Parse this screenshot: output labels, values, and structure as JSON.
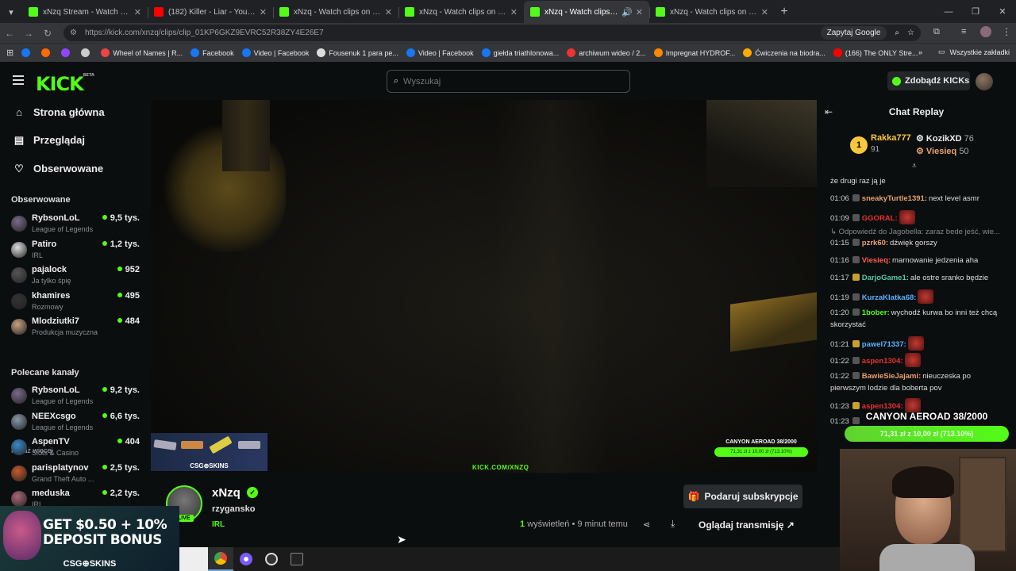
{
  "browser": {
    "tabs": [
      {
        "label": "xNzq Stream - Watch Live on Kick",
        "favicon_color": "#53fc18"
      },
      {
        "label": "(182) Killer - Liar - YouTube",
        "favicon_color": "#ff0000"
      },
      {
        "label": "xNzq - Watch clips on Kick",
        "favicon_color": "#53fc18"
      },
      {
        "label": "xNzq - Watch clips on Kick",
        "favicon_color": "#53fc18"
      },
      {
        "label": "xNzq - Watch clips on Kick",
        "favicon_color": "#53fc18",
        "active": true
      },
      {
        "label": "xNzq - Watch clips on Kick",
        "favicon_color": "#53fc18"
      }
    ],
    "url": "https://kick.com/xnzq/clips/clip_01KP6GKZ9EVRC52R38ZY4E26E7",
    "ask_google": "Zapytaj Google",
    "bookmarks": [
      {
        "label": "",
        "color": "#1877f2"
      },
      {
        "label": "",
        "color": "#ff6a00"
      },
      {
        "label": "",
        "color": "#9146ff"
      },
      {
        "label": "",
        "color": "#cccccc"
      },
      {
        "label": "Wheel of Names | R...",
        "color": "#e44"
      },
      {
        "label": "Facebook",
        "color": "#1877f2"
      },
      {
        "label": "Video | Facebook",
        "color": "#1877f2"
      },
      {
        "label": "Fousenuk 1 para pe...",
        "color": "#ddd"
      },
      {
        "label": "Video | Facebook",
        "color": "#1877f2"
      },
      {
        "label": "giełda triathlonowa...",
        "color": "#1877f2"
      },
      {
        "label": "archiwum wideo / 2...",
        "color": "#e33"
      },
      {
        "label": "Impregnat HYDROF...",
        "color": "#f80"
      },
      {
        "label": "Ćwiczenia na biodra...",
        "color": "#fa0"
      },
      {
        "label": "(166) The ONLY Stre...",
        "color": "#f00"
      }
    ],
    "all_bookmarks": "Wszystkie zakładki"
  },
  "header": {
    "logo": "KICK",
    "logo_sup": "BETA",
    "search_placeholder": "Wyszukaj",
    "kicks_button": "Zdobądź KICKs"
  },
  "sidebar": {
    "nav": [
      {
        "label": "Strona główna",
        "icon": "home-icon"
      },
      {
        "label": "Przeglądaj",
        "icon": "browse-icon"
      },
      {
        "label": "Obserwowane",
        "icon": "heart-icon"
      }
    ],
    "followed_title": "Obserwowane",
    "followed": [
      {
        "name": "RybsonLoL",
        "category": "League of Legends",
        "viewers": "9,5 tys.",
        "color": "#7a6a8a"
      },
      {
        "name": "Patiro",
        "category": "IRL",
        "viewers": "1,2 tys.",
        "color": "#ddd"
      },
      {
        "name": "pajalock",
        "category": "Ja tylko śpię",
        "viewers": "952",
        "color": "#555"
      },
      {
        "name": "khamires",
        "category": "Rozmowy",
        "viewers": "495",
        "color": "#333"
      },
      {
        "name": "Mlodziutki7",
        "category": "Produkcja muzyczna",
        "viewers": "484",
        "color": "#c8a080"
      }
    ],
    "show_more": "Pokaż więcej",
    "recommended_title": "Polecane kanały",
    "recommended": [
      {
        "name": "RybsonLoL",
        "category": "League of Legends",
        "viewers": "9,2 tys.",
        "color": "#7a6a8a"
      },
      {
        "name": "NEEXcsgo",
        "category": "League of Legends",
        "viewers": "6,6 tys.",
        "color": "#8899aa"
      },
      {
        "name": "AspenTV",
        "category": "Slots & Casino",
        "viewers": "404",
        "color": "#3a8ac8"
      },
      {
        "name": "parisplatynov",
        "category": "Grand Theft Auto ...",
        "viewers": "2,5 tys.",
        "color": "#c85a2a"
      },
      {
        "name": "meduska",
        "category": "IRL",
        "viewers": "2,2 tys.",
        "color": "#aa6677"
      }
    ]
  },
  "video": {
    "overlay_url": "KICK.COM/XNZQ",
    "csg_label": "CSG⊕SKINS",
    "goal_title": "CANYON AEROAD 38/2000",
    "goal_progress": "71,31 zł z 10,00 zł (713.10%)"
  },
  "channel": {
    "name": "xNzq",
    "live": "LIVE",
    "title": "rzygansko",
    "category": "IRL",
    "subscribe_button": "Podaruj subskrypcje",
    "views_count": "1",
    "views_label": "wyświetleń",
    "time_ago": "• 9 minut temu",
    "watch_button": "Oglądaj transmisję"
  },
  "chat": {
    "title": "Chat Replay",
    "top": [
      {
        "name": "Rakka777",
        "amount": "91"
      },
      {
        "name": "KozikXD",
        "amount": "76"
      },
      {
        "name": "Viesieq",
        "amount": "50"
      }
    ],
    "messages": [
      {
        "time": "",
        "user": "",
        "color": "#ddd",
        "text": "że drugi raz ją je"
      },
      {
        "time": "01:06",
        "user": "sneakyTurtle1391:",
        "color": "#e8a070",
        "text": "next level asmr"
      },
      {
        "time": "01:09",
        "user": "GGORAL:",
        "color": "#e83030",
        "text": ""
      },
      {
        "time": "",
        "user": "",
        "color": "#888",
        "text": "↳ Odpowiedź do Jagobella: zaraz bede jeść, wie..."
      },
      {
        "time": "01:15",
        "user": "pzrk60:",
        "color": "#e8a070",
        "text": "dźwięk gorszy"
      },
      {
        "time": "01:16",
        "user": "Viesieq:",
        "color": "#ff5a5a",
        "text": "marnowanie jedzenia aha"
      },
      {
        "time": "01:17",
        "user": "DarjoGame1:",
        "color": "#53c8a8",
        "text": "ale ostre sranko będzie"
      },
      {
        "time": "01:19",
        "user": "KurzaKlatka68:",
        "color": "#5ab0ff",
        "text": ""
      },
      {
        "time": "01:20",
        "user": "1bober:",
        "color": "#53fc18",
        "text": "wychodź kurwa bo inni też chcą skorzystać"
      },
      {
        "time": "01:21",
        "user": "pawel71337:",
        "color": "#5ab0ff",
        "text": ""
      },
      {
        "time": "01:22",
        "user": "aspen1304:",
        "color": "#e83030",
        "text": ""
      },
      {
        "time": "01:22",
        "user": "BawieSieJajami:",
        "color": "#e8a070",
        "text": "nieuczeska po pierwszym lodzie dla boberta pov"
      },
      {
        "time": "01:23",
        "user": "aspen1304:",
        "color": "#e83030",
        "text": ""
      },
      {
        "time": "01:23",
        "user": "",
        "color": "#ddd",
        "text": ""
      }
    ],
    "goal_title": "CANYON AEROAD 38/2000",
    "goal_progress": "71,31 zł z 10,00 zł (713.10%)"
  },
  "ad": {
    "line1": "GET $0.50 + 10%",
    "line2": "DEPOSIT BONUS",
    "brand": "CSG⊕SKINS"
  }
}
